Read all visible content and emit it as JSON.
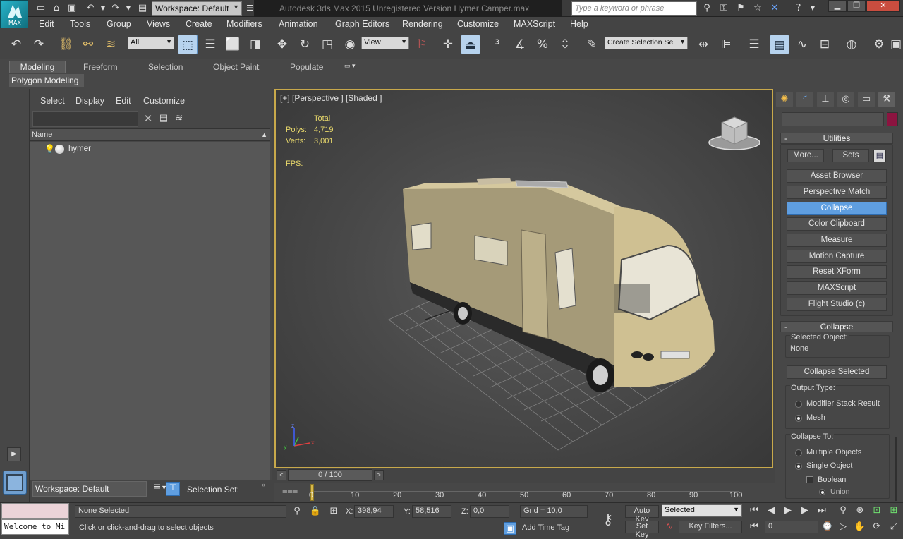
{
  "window": {
    "title": "Autodesk 3ds Max  2015    Unregistered Version    Hymer Camper.max",
    "logo_text": "MAX",
    "workspace_label": "Workspace: Default",
    "search_placeholder": "Type a keyword or phrase"
  },
  "menu": [
    "Edit",
    "Tools",
    "Group",
    "Views",
    "Create",
    "Modifiers",
    "Animation",
    "Graph Editors",
    "Rendering",
    "Customize",
    "MAXScript",
    "Help"
  ],
  "toolbar": {
    "filter_value": "All",
    "ref_coord_value": "View",
    "selection_set_value": "Create Selection Se"
  },
  "ribbon": {
    "tabs": [
      "Modeling",
      "Freeform",
      "Selection",
      "Object Paint",
      "Populate"
    ],
    "active_panel": "Polygon Modeling"
  },
  "scene_explorer": {
    "tabs": [
      "Select",
      "Display",
      "Edit",
      "Customize"
    ],
    "column_name": "Name",
    "objects": [
      "hymer"
    ],
    "workspace": "Workspace: Default",
    "selection_set_label": "Selection Set:"
  },
  "viewport": {
    "label": "[+] [Perspective ] [Shaded ]",
    "stats_title": "Total",
    "polys_label": "Polys:",
    "polys_value": "4,719",
    "verts_label": "Verts:",
    "verts_value": "3,001",
    "fps_label": "FPS:"
  },
  "utilities": {
    "title": "Utilities",
    "more_label": "More...",
    "sets_label": "Sets",
    "items": [
      "Asset Browser",
      "Perspective Match",
      "Collapse",
      "Color Clipboard",
      "Measure",
      "Motion Capture",
      "Reset XForm",
      "MAXScript",
      "Flight Studio (c)"
    ],
    "active_item": "Collapse"
  },
  "collapse": {
    "title": "Collapse",
    "selected_object_label": "Selected Object:",
    "selected_object_value": "None",
    "collapse_selected_label": "Collapse Selected",
    "output_type_label": "Output Type:",
    "output_options": [
      "Modifier Stack Result",
      "Mesh"
    ],
    "output_selected": "Mesh",
    "collapse_to_label": "Collapse To:",
    "collapse_to_options": [
      "Multiple Objects",
      "Single Object"
    ],
    "collapse_to_selected": "Single Object",
    "boolean_label": "Boolean",
    "union_label": "Union"
  },
  "timeline": {
    "frame_display": "0 / 100",
    "ticks": [
      "0",
      "10",
      "20",
      "30",
      "40",
      "50",
      "60",
      "70",
      "80",
      "90",
      "100"
    ],
    "current_frame": 0,
    "total_frames": 100
  },
  "status": {
    "maxscript_text": "Welcome to Mi",
    "selection_text": "None Selected",
    "prompt_text": "Click or click-and-drag to select objects",
    "x_label": "X:",
    "x_value": "398,94",
    "y_label": "Y:",
    "y_value": "58,516",
    "z_label": "Z:",
    "z_value": "0,0",
    "grid_text": "Grid = 10,0",
    "add_time_tag": "Add Time Tag",
    "auto_key": "Auto Key",
    "set_key": "Set Key",
    "key_mode_value": "Selected",
    "key_filters": "Key Filters...",
    "frame_field": "0"
  },
  "colors": {
    "accent_blue": "#5f9ee0",
    "viewport_border": "#c8a94b",
    "stats_yellow": "#e8d86b",
    "logo_teal": "#27b3c9"
  }
}
